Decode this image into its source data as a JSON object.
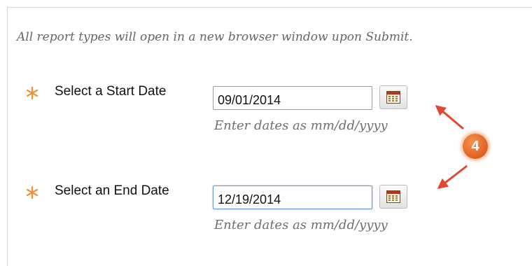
{
  "info_text": "All report types will open in a new browser window upon Submit.",
  "start_date": {
    "label": "Select a Start Date",
    "value": "09/01/2014",
    "hint": "Enter dates as mm/dd/yyyy"
  },
  "end_date": {
    "label": "Select an End Date",
    "value": "12/19/2014",
    "hint": "Enter dates as mm/dd/yyyy"
  },
  "callout": {
    "number": "4",
    "color": "#e86d2c"
  },
  "colors": {
    "required_star": "#f0923a",
    "arrow": "#e2472f",
    "focus_border": "#6a97d3"
  },
  "icons": {
    "required": "required-star-icon",
    "calendar": "calendar-icon"
  }
}
